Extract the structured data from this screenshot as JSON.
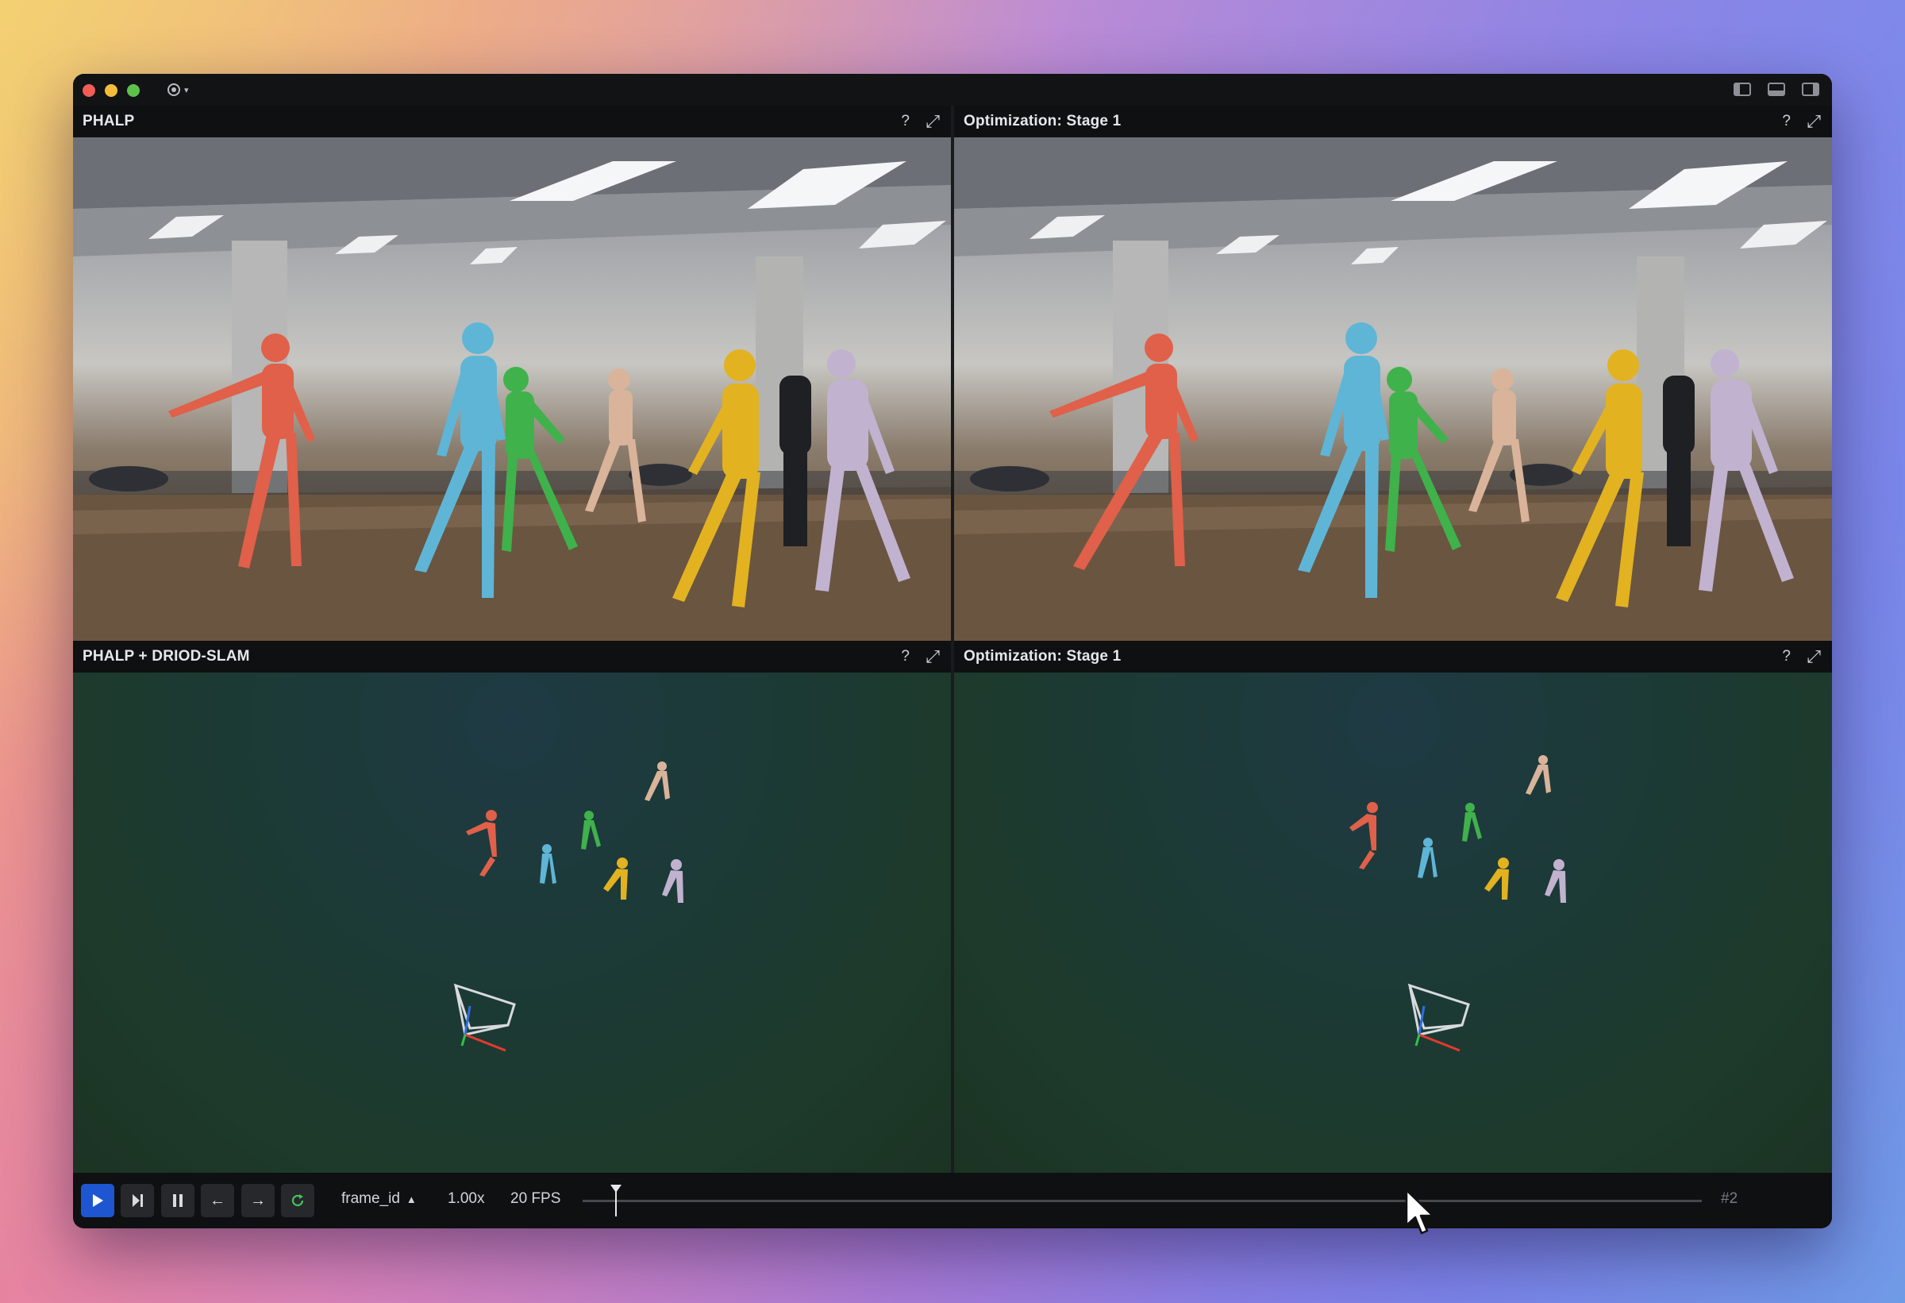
{
  "app": {
    "menu_icon": "recording-icon"
  },
  "panels": [
    {
      "title": "PHALP",
      "help": "?",
      "expand_icon": "expand-icon"
    },
    {
      "title": "Optimization: Stage 1",
      "help": "?",
      "expand_icon": "expand-icon"
    },
    {
      "title": "PHALP + DRIOD-SLAM",
      "help": "?",
      "expand_icon": "expand-icon"
    },
    {
      "title": "Optimization: Stage 1",
      "help": "?",
      "expand_icon": "expand-icon"
    }
  ],
  "playback": {
    "timeline_selector": "frame_id",
    "speed": "1.00x",
    "fps": "20 FPS",
    "frame": "#2",
    "progress": 0.03
  },
  "colors": {
    "accent": "#1e56d1",
    "loop": "#44c45a",
    "person_red": "#e0604a",
    "person_blue": "#5fb5d6",
    "person_green": "#3fb24b",
    "person_tan": "#d9b49a",
    "person_yellow": "#e2b221",
    "person_lavender": "#c1b2cf"
  }
}
